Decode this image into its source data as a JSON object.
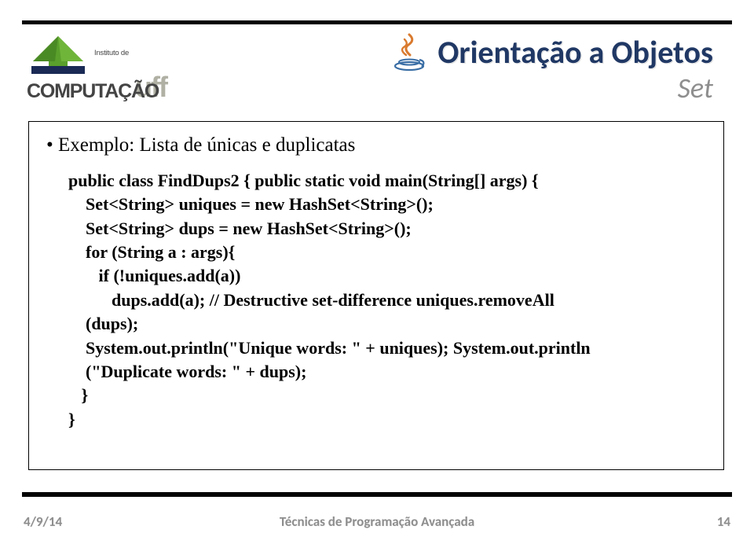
{
  "header": {
    "title": "Orientação a Objetos",
    "subtitle": "Set",
    "logo": {
      "line1": "Instituto de",
      "line2": "COMPUTAÇÃO",
      "brand": "uff"
    },
    "java_icon": "java-icon"
  },
  "content": {
    "bullet": "• Exemplo: Lista de únicas e duplicatas",
    "code_lines": [
      "public class FindDups2 { public static void main(String[] args) {",
      "    Set<String> uniques = new HashSet<String>();",
      "    Set<String> dups = new HashSet<String>();",
      "    for (String a : args){",
      "       if (!uniques.add(a))",
      "          dups.add(a); // Destructive set-difference uniques.removeAll",
      "    (dups);",
      "    System.out.println(\"Unique words: \" + uniques); System.out.println",
      "    (\"Duplicate words: \" + dups);",
      "   }",
      "}"
    ]
  },
  "footer": {
    "date": "4/9/14",
    "center": "Técnicas de Programação Avançada",
    "page": "14"
  }
}
